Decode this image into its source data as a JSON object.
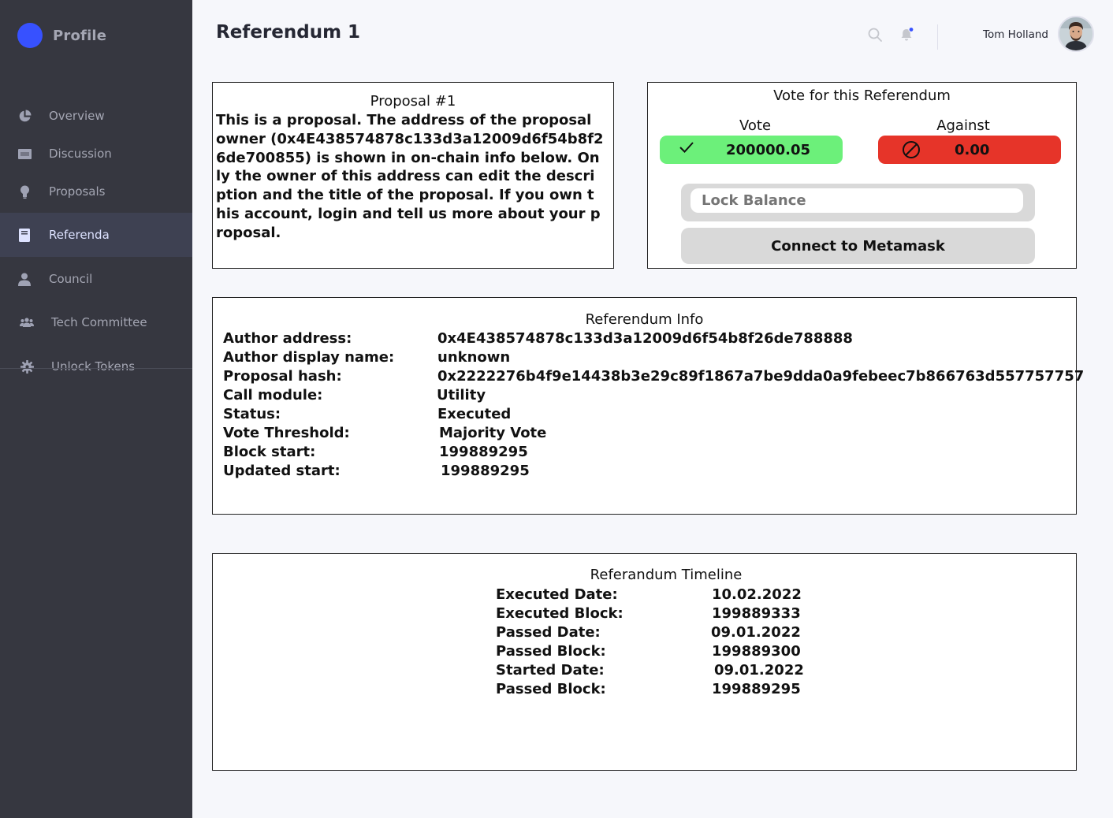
{
  "sidebar": {
    "brand": "Profile",
    "items": [
      {
        "label": "Overview",
        "icon": "pie-chart-icon"
      },
      {
        "label": "Discussion",
        "icon": "ticket-icon"
      },
      {
        "label": "Proposals",
        "icon": "lightbulb-icon"
      },
      {
        "label": "Referenda",
        "icon": "book-icon"
      },
      {
        "label": "Council",
        "icon": "person-icon"
      },
      {
        "label": "Tech Committee",
        "icon": "group-icon"
      },
      {
        "label": "Unlock Tokens",
        "icon": "gear-icon"
      }
    ],
    "active": "Referenda"
  },
  "header": {
    "title": "Referendum 1",
    "user_name": "Tom Holland",
    "notification_dot_color": "#3751ff"
  },
  "proposal": {
    "title": "Proposal #1",
    "body": "This is a proposal. The address of the proposal owner (0x4E438574878c133d3a12009d6f54b8f26de700855) is shown in on-chain info below. Only the owner of this address can edit the description and the title of the proposal. If you own this account, login and tell us more about your proposal."
  },
  "vote": {
    "title": "Vote for this Referendum",
    "aye_label": "Vote",
    "nay_label": "Against",
    "aye_value": "200000.05",
    "nay_value": "0.00",
    "lock_balance_placeholder": "Lock Balance",
    "connect_label": "Connect to Metamask",
    "aye_color": "#6cf07a",
    "nay_color": "#e63429"
  },
  "referendum_info": {
    "title": "Referendum Info",
    "rows": [
      {
        "key": "Author address:",
        "value": "0x4E438574878c133d3a12009d6f54b8f26de788888"
      },
      {
        "key": "Author display name:",
        "value": "unknown"
      },
      {
        "key": "Proposal hash:",
        "value": "0x2222276b4f9e14438b3e29c89f1867a7be9dda0a9febeec7b866763d557757757"
      },
      {
        "key": "Call module:",
        "value": "Utility"
      },
      {
        "key": "Status:",
        "value": "Executed"
      },
      {
        "key": "Vote Threshold:",
        "value": "Majority Vote"
      },
      {
        "key": "Block start:",
        "value": "199889295"
      },
      {
        "key": "Updated start:",
        "value": "199889295"
      }
    ]
  },
  "timeline": {
    "title": "Referandum Timeline",
    "rows": [
      {
        "key": "Executed Date:",
        "value": "10.02.2022"
      },
      {
        "key": "Executed Block:",
        "value": "199889333"
      },
      {
        "key": "Passed Date:",
        "value": "09.01.2022"
      },
      {
        "key": "Passed Block:",
        "value": "199889300"
      },
      {
        "key": "Started Date:",
        "value": "09.01.2022"
      },
      {
        "key": "Passed Block:",
        "value": "199889295"
      }
    ]
  }
}
